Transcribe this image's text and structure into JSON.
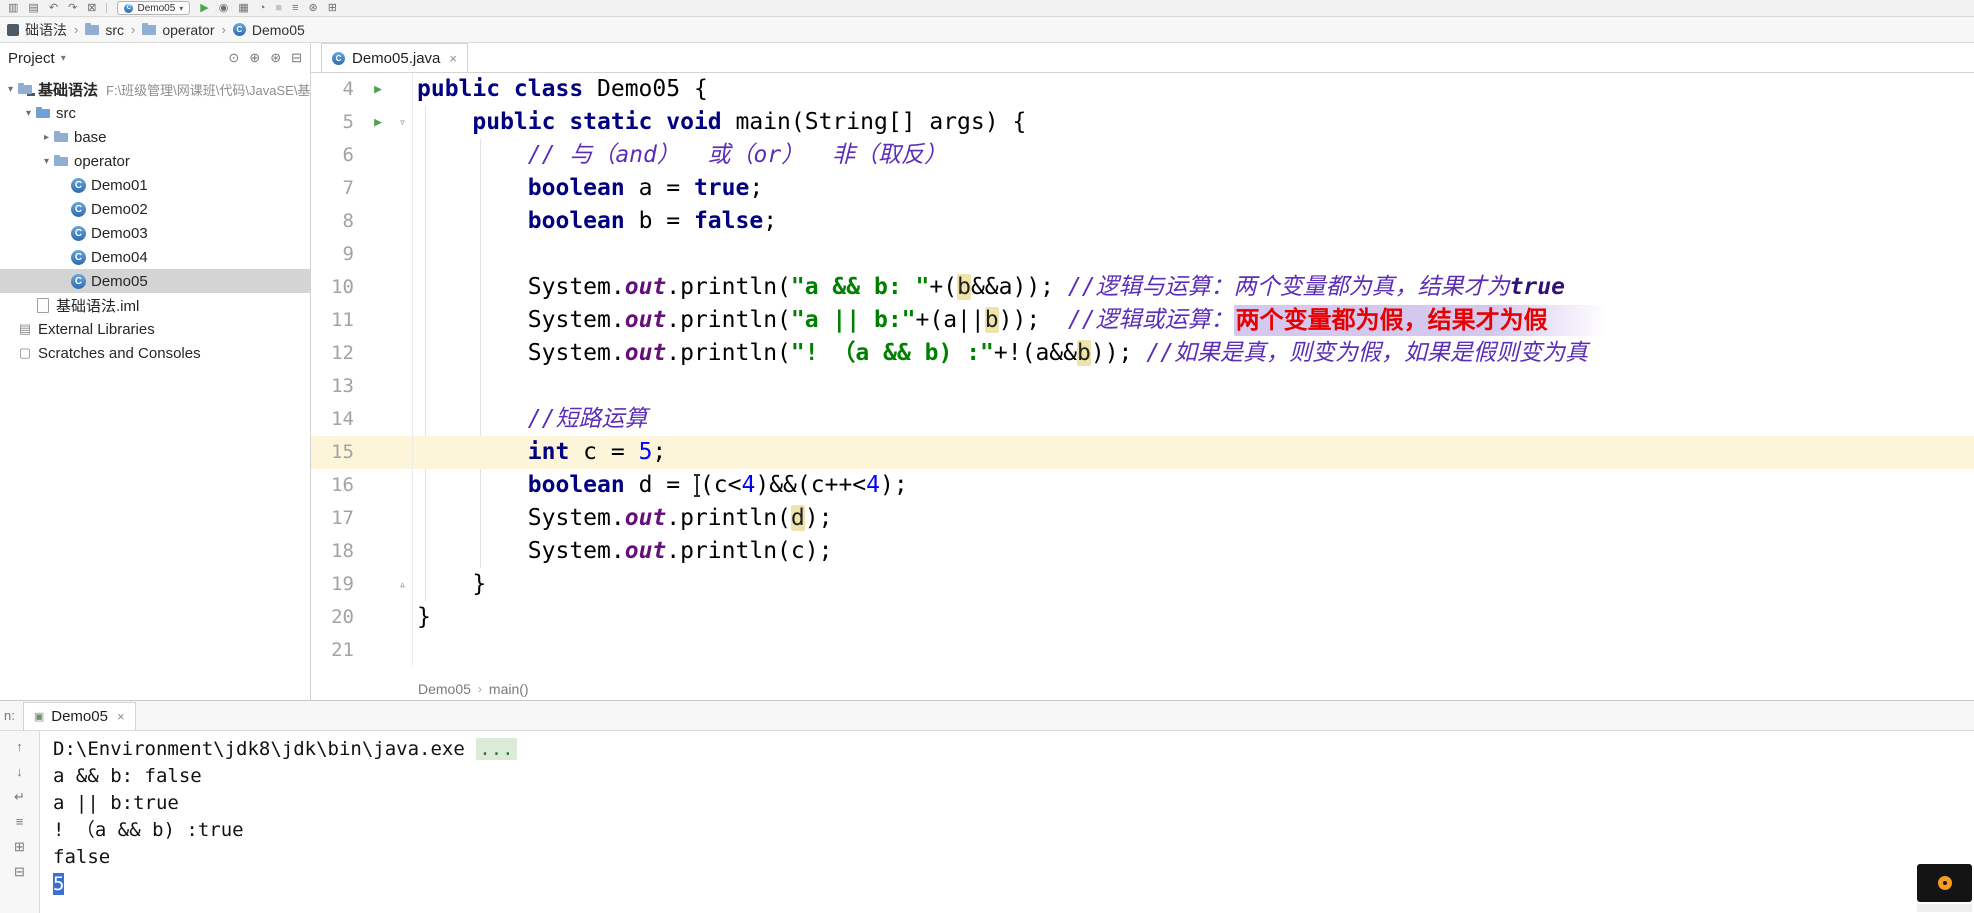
{
  "toolbar": {
    "run_config": "Demo05",
    "run_config_glyph": "C",
    "icons_left": [
      {
        "name": "open-project-icon",
        "glyph": "▥"
      },
      {
        "name": "save-all-icon",
        "glyph": "▤"
      },
      {
        "name": "undo-icon",
        "glyph": "↶"
      },
      {
        "name": "redo-icon",
        "glyph": "↷"
      },
      {
        "name": "build-icon",
        "glyph": "⊠"
      }
    ],
    "icons_right": [
      {
        "name": "run-button",
        "glyph": "▶",
        "color": "#4FA54F"
      },
      {
        "name": "debug-button",
        "glyph": "◉",
        "color": "#6E6E6E"
      },
      {
        "name": "coverage-button",
        "glyph": "▦",
        "color": "#6E6E6E"
      },
      {
        "name": "profiler-button",
        "glyph": "◔",
        "color": "#6E6E6E"
      },
      {
        "name": "stop-button",
        "glyph": "■",
        "color": "#C4C4C4"
      },
      {
        "name": "search-everywhere-button",
        "glyph": "≡",
        "color": "#6E6E6E"
      },
      {
        "name": "settings-button",
        "glyph": "⊛",
        "color": "#6E6E6E"
      },
      {
        "name": "layout-button",
        "glyph": "⊞",
        "color": "#6E6E6E"
      }
    ]
  },
  "breadcrumbs": {
    "separator": "›",
    "items": [
      {
        "label": "础语法",
        "icon": "project"
      },
      {
        "label": "src",
        "icon": "folder"
      },
      {
        "label": "operator",
        "icon": "folder"
      },
      {
        "label": "Demo05",
        "icon": "class",
        "glyph": "C"
      }
    ]
  },
  "project": {
    "title": "Project",
    "title_arrow": "▾",
    "header_icons": [
      {
        "name": "locate-file-icon",
        "glyph": "⊙"
      },
      {
        "name": "expand-all-icon",
        "glyph": "⊕"
      },
      {
        "name": "settings-icon",
        "glyph": "⊛"
      },
      {
        "name": "collapse-all-icon",
        "glyph": "⊟"
      }
    ],
    "tree": [
      {
        "label": "基础语法",
        "path": "F:\\班级管理\\网课班\\代码\\JavaSE\\基础",
        "indent": 0,
        "icon": "project",
        "arrow": "down",
        "bold": true
      },
      {
        "label": "src",
        "indent": 1,
        "icon": "folder-src",
        "arrow": "down"
      },
      {
        "label": "base",
        "indent": 2,
        "icon": "folder",
        "arrow": "right"
      },
      {
        "label": "operator",
        "indent": 2,
        "icon": "folder",
        "arrow": "down"
      },
      {
        "label": "Demo01",
        "indent": 3,
        "icon": "class",
        "glyph": "C"
      },
      {
        "label": "Demo02",
        "indent": 3,
        "icon": "class",
        "glyph": "C"
      },
      {
        "label": "Demo03",
        "indent": 3,
        "icon": "class",
        "glyph": "C"
      },
      {
        "label": "Demo04",
        "indent": 3,
        "icon": "class",
        "glyph": "C"
      },
      {
        "label": "Demo05",
        "indent": 3,
        "icon": "class",
        "glyph": "C",
        "selected": true
      },
      {
        "label": "基础语法.iml",
        "indent": 1,
        "icon": "file"
      },
      {
        "label": "External Libraries",
        "indent": 0,
        "icon": "library",
        "glyph": "▤"
      },
      {
        "label": "Scratches and Consoles",
        "indent": 0,
        "icon": "scratch",
        "glyph": "▢"
      }
    ]
  },
  "editor": {
    "tab": {
      "label": "Demo05.java",
      "glyph": "C",
      "close": "×"
    },
    "breadcrumb": [
      "Demo05",
      "main()"
    ],
    "gutter_glyphs": {
      "run": "▶",
      "fold_open": "▿",
      "fold_close": "▵"
    },
    "lines": [
      {
        "num": 4,
        "g": "run",
        "s": [
          {
            "t": "public class ",
            "c": "kw"
          },
          {
            "t": "Demo05 {",
            "c": "pl"
          }
        ]
      },
      {
        "num": 5,
        "g": "run-fold",
        "s": [
          {
            "t": "    ",
            "c": "pl"
          },
          {
            "t": "public static void ",
            "c": "kw"
          },
          {
            "t": "main(String[] args) {",
            "c": "pl"
          }
        ]
      },
      {
        "num": 6,
        "s": [
          {
            "t": "        ",
            "c": "pl"
          },
          {
            "t": "// 与（and）  或（or）  非（取反）",
            "c": "cm"
          }
        ]
      },
      {
        "num": 7,
        "s": [
          {
            "t": "        ",
            "c": "pl"
          },
          {
            "t": "boolean ",
            "c": "kw"
          },
          {
            "t": "a = ",
            "c": "pl"
          },
          {
            "t": "true",
            "c": "kw"
          },
          {
            "t": ";",
            "c": "pl"
          }
        ]
      },
      {
        "num": 8,
        "s": [
          {
            "t": "        ",
            "c": "pl"
          },
          {
            "t": "boolean ",
            "c": "kw"
          },
          {
            "t": "b = ",
            "c": "pl"
          },
          {
            "t": "false",
            "c": "kw"
          },
          {
            "t": ";",
            "c": "pl"
          }
        ]
      },
      {
        "num": 9,
        "s": []
      },
      {
        "num": 10,
        "s": [
          {
            "t": "        System.",
            "c": "pl"
          },
          {
            "t": "out",
            "c": "fld"
          },
          {
            "t": ".println(",
            "c": "pl"
          },
          {
            "t": "\"a && b: \"",
            "c": "str"
          },
          {
            "t": "+(",
            "c": "pl"
          },
          {
            "t": "b",
            "c": "hl"
          },
          {
            "t": "&&a)); ",
            "c": "pl"
          },
          {
            "t": "//逻辑与运算：两个变量都为真，结果才为",
            "c": "cm"
          },
          {
            "t": "true",
            "c": "cmb"
          }
        ]
      },
      {
        "num": 11,
        "s": [
          {
            "t": "        System.",
            "c": "pl"
          },
          {
            "t": "out",
            "c": "fld"
          },
          {
            "t": ".println(",
            "c": "pl"
          },
          {
            "t": "\"a || b:\"",
            "c": "str"
          },
          {
            "t": "+(a||",
            "c": "pl"
          },
          {
            "t": "b",
            "c": "hl"
          },
          {
            "t": "));  ",
            "c": "pl"
          },
          {
            "t": "//逻辑或运算：",
            "c": "cm"
          },
          {
            "t": "两个变量都为假，结果才为假",
            "c": "red"
          }
        ]
      },
      {
        "num": 12,
        "s": [
          {
            "t": "        System.",
            "c": "pl"
          },
          {
            "t": "out",
            "c": "fld"
          },
          {
            "t": ".println(",
            "c": "pl"
          },
          {
            "t": "\"! （a && b) :\"",
            "c": "str"
          },
          {
            "t": "+!(a&&",
            "c": "pl"
          },
          {
            "t": "b",
            "c": "hl"
          },
          {
            "t": ")); ",
            "c": "pl"
          },
          {
            "t": "//如果是真，则变为假，如果是假则变为真",
            "c": "cm"
          }
        ]
      },
      {
        "num": 13,
        "s": []
      },
      {
        "num": 14,
        "s": [
          {
            "t": "        ",
            "c": "pl"
          },
          {
            "t": "//短路运算",
            "c": "cm"
          }
        ]
      },
      {
        "num": 15,
        "current": true,
        "s": [
          {
            "t": "        ",
            "c": "pl"
          },
          {
            "t": "int ",
            "c": "kw"
          },
          {
            "t": "c = ",
            "c": "pl"
          },
          {
            "t": "5",
            "c": "num"
          },
          {
            "t": ";",
            "c": "pl"
          }
        ]
      },
      {
        "num": 16,
        "s": [
          {
            "t": "        ",
            "c": "pl"
          },
          {
            "t": "boolean ",
            "c": "kw"
          },
          {
            "t": "d = ",
            "c": "pl"
          },
          {
            "t": "",
            "c": "ibeam"
          },
          {
            "t": "(c<",
            "c": "pl"
          },
          {
            "t": "4",
            "c": "num"
          },
          {
            "t": ")&&(c++<",
            "c": "pl"
          },
          {
            "t": "4",
            "c": "num"
          },
          {
            "t": ");",
            "c": "pl"
          }
        ]
      },
      {
        "num": 17,
        "s": [
          {
            "t": "        System.",
            "c": "pl"
          },
          {
            "t": "out",
            "c": "fld"
          },
          {
            "t": ".println(",
            "c": "pl"
          },
          {
            "t": "d",
            "c": "hl"
          },
          {
            "t": ");",
            "c": "pl"
          }
        ]
      },
      {
        "num": 18,
        "s": [
          {
            "t": "        System.",
            "c": "pl"
          },
          {
            "t": "out",
            "c": "fld"
          },
          {
            "t": ".println(c);",
            "c": "pl"
          }
        ]
      },
      {
        "num": 19,
        "g": "fold-end",
        "s": [
          {
            "t": "    }",
            "c": "pl"
          }
        ]
      },
      {
        "num": 20,
        "s": [
          {
            "t": "}",
            "c": "pl"
          }
        ]
      },
      {
        "num": 21,
        "s": []
      }
    ]
  },
  "console": {
    "label_prefix": "n:",
    "tab": {
      "label": "Demo05",
      "glyph": "▣",
      "close": "×"
    },
    "gutter_icons": [
      {
        "name": "prev-occurrence-icon",
        "glyph": "↑"
      },
      {
        "name": "next-occurrence-icon",
        "glyph": "↓"
      },
      {
        "name": "soft-wrap-icon",
        "glyph": "↵"
      },
      {
        "name": "scroll-to-end-icon",
        "glyph": "≡"
      },
      {
        "name": "print-icon",
        "glyph": "⊞"
      },
      {
        "name": "clear-all-icon",
        "glyph": "⊟"
      }
    ],
    "lines": [
      {
        "s": [
          {
            "t": "D:\\Environment\\jdk8\\jdk\\bin\\java.exe ",
            "c": "pl"
          },
          {
            "t": "...",
            "c": "fold"
          }
        ]
      },
      {
        "s": [
          {
            "t": "a && b: false",
            "c": "pl"
          }
        ]
      },
      {
        "s": [
          {
            "t": "a || b:true",
            "c": "pl"
          }
        ]
      },
      {
        "s": [
          {
            "t": "! （a && b) :true",
            "c": "pl"
          }
        ]
      },
      {
        "s": [
          {
            "t": "false",
            "c": "pl"
          }
        ]
      },
      {
        "s": [
          {
            "t": "5",
            "c": "sel"
          }
        ]
      }
    ]
  },
  "colors": {
    "keyword": "#000080",
    "string": "#008000",
    "number": "#0000FF",
    "comment": "#5C2EB8",
    "field": "#660E7A",
    "annotation_red": "#E60000",
    "current_line_bg": "#FCF5DA",
    "usage_highlight_bg": "#EFE3AC",
    "selection_bg": "#3B6FD4",
    "run_green": "#4FA54F"
  }
}
